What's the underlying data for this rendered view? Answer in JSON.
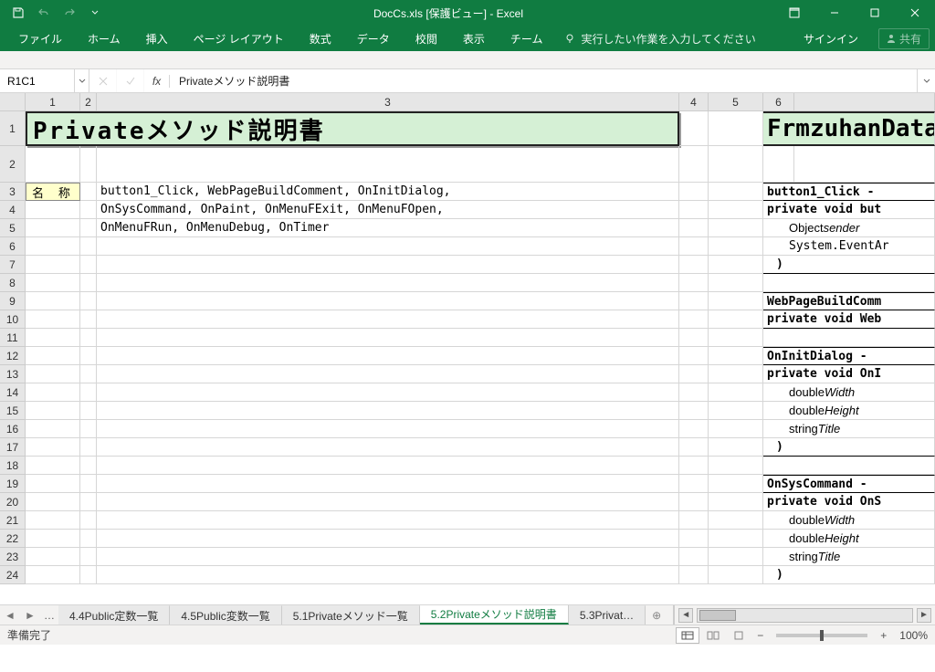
{
  "titlebar": {
    "doc": "DocCs.xls",
    "mode": "[保護ビュー]",
    "app": "- Excel"
  },
  "ribbon": {
    "tabs": [
      "ファイル",
      "ホーム",
      "挿入",
      "ページ レイアウト",
      "数式",
      "データ",
      "校閲",
      "表示",
      "チーム"
    ],
    "tellme": "実行したい作業を入力してください",
    "signin": "サインイン",
    "share": "共有"
  },
  "fbar": {
    "name": "R1C1",
    "formula": "Privateメソッド説明書"
  },
  "cols": [
    "1",
    "2",
    "3",
    "4",
    "5",
    "6"
  ],
  "rowheads": [
    "1",
    "2",
    "3",
    "4",
    "5",
    "6",
    "7",
    "8",
    "9",
    "10",
    "11",
    "12",
    "13",
    "14",
    "15",
    "16",
    "17",
    "18",
    "19",
    "20",
    "21",
    "22",
    "23",
    "24"
  ],
  "doc": {
    "title": "Privateメソッド説明書",
    "righttitle": "FrmzuhanData.c",
    "label": "名 称",
    "methods": [
      "button1_Click, WebPageBuildComment, OnInitDialog,",
      "OnSysCommand, OnPaint, OnMenuFExit, OnMenuFOpen,",
      "OnMenuFRun, OnMenuDebug, OnTimer"
    ],
    "side": {
      "r3": "button1_Click -",
      "r4": "private void but",
      "r5": "Object sender",
      "r6": "System.EventAr",
      "r7": ")",
      "r9": "WebPageBuildComm",
      "r10": "private void Web",
      "r12": "OnInitDialog - ",
      "r13": "private void OnI",
      "r14": "double Width",
      "r15": "double Height",
      "r16": "string Title",
      "r17": ")",
      "r19": "OnSysCommand - ",
      "r20": "private void OnS",
      "r21": "double Width",
      "r22": "double Height",
      "r23": "string Title",
      "r24": ")"
    }
  },
  "sheettabs": {
    "tabs": [
      "4.4Public定数一覧",
      "4.5Public変数一覧",
      "5.1Privateメソッド一覧",
      "5.2Privateメソッド説明書",
      "5.3Privat"
    ],
    "active": 3
  },
  "status": {
    "ready": "準備完了",
    "zoom": "100%"
  }
}
